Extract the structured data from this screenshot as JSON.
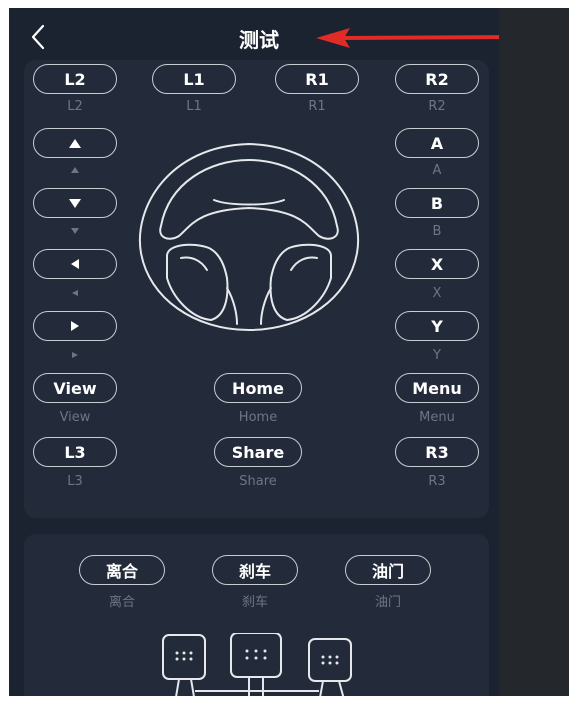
{
  "header": {
    "title": "测试",
    "back_icon": "chevron-left-icon"
  },
  "annotation": {
    "arrow_color": "#e02b27"
  },
  "buttons": {
    "l2": {
      "label": "L2",
      "sub": "L2"
    },
    "l1": {
      "label": "L1",
      "sub": "L1"
    },
    "r1": {
      "label": "R1",
      "sub": "R1"
    },
    "r2": {
      "label": "R2",
      "sub": "R2"
    },
    "dpad_up": {
      "icon": "triangle-up-icon"
    },
    "dpad_down": {
      "icon": "triangle-down-icon"
    },
    "dpad_left": {
      "icon": "triangle-left-icon"
    },
    "dpad_right": {
      "icon": "triangle-right-icon"
    },
    "a": {
      "label": "A",
      "sub": "A"
    },
    "b": {
      "label": "B",
      "sub": "B"
    },
    "x": {
      "label": "X",
      "sub": "X"
    },
    "y": {
      "label": "Y",
      "sub": "Y"
    },
    "view": {
      "label": "View",
      "sub": "View"
    },
    "home": {
      "label": "Home",
      "sub": "Home"
    },
    "menu": {
      "label": "Menu",
      "sub": "Menu"
    },
    "l3": {
      "label": "L3",
      "sub": "L3"
    },
    "share": {
      "label": "Share",
      "sub": "Share"
    },
    "r3": {
      "label": "R3",
      "sub": "R3"
    }
  },
  "pedal_buttons": {
    "clutch": {
      "label": "离合",
      "sub": "离合"
    },
    "brake": {
      "label": "刹车",
      "sub": "刹车"
    },
    "throttle": {
      "label": "油门",
      "sub": "油门"
    }
  },
  "colors": {
    "background": "#1b2230",
    "card": "#232b3a",
    "outline": "#c9ccd2",
    "sub_text": "#6e7686"
  }
}
